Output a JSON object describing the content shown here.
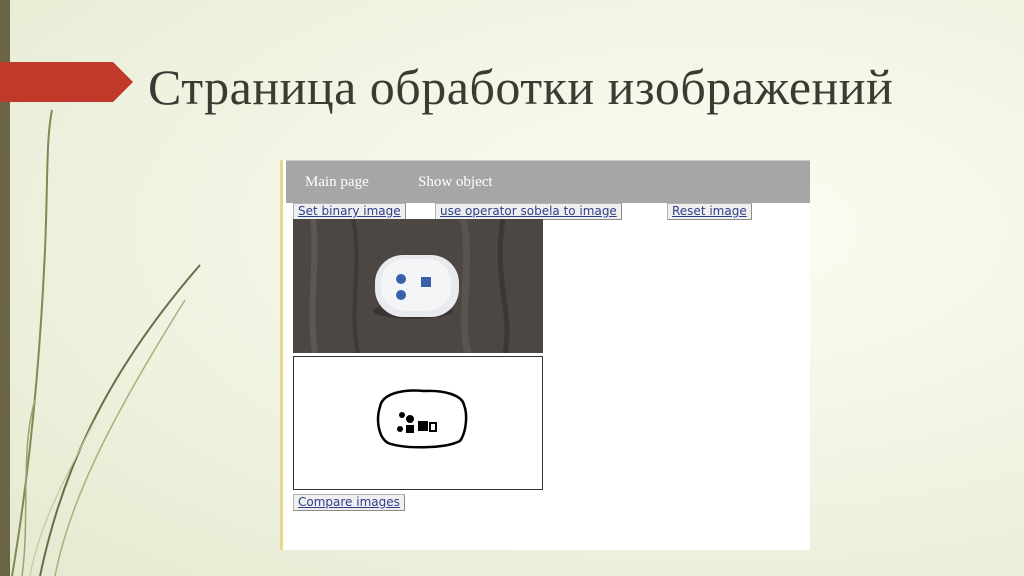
{
  "slide": {
    "title": "Страница обработки изображений"
  },
  "app": {
    "nav": [
      "Main page",
      "Show object"
    ],
    "buttons": {
      "binary": "Set binary image",
      "sobel": "use operator sobela to image",
      "reset": "Reset image",
      "compare": "Compare images"
    }
  },
  "colors": {
    "accent_arrow": "#c0392b",
    "navbar": "#a6a6a6",
    "link": "#2f3f8a",
    "side_bar": "#6b6446"
  }
}
